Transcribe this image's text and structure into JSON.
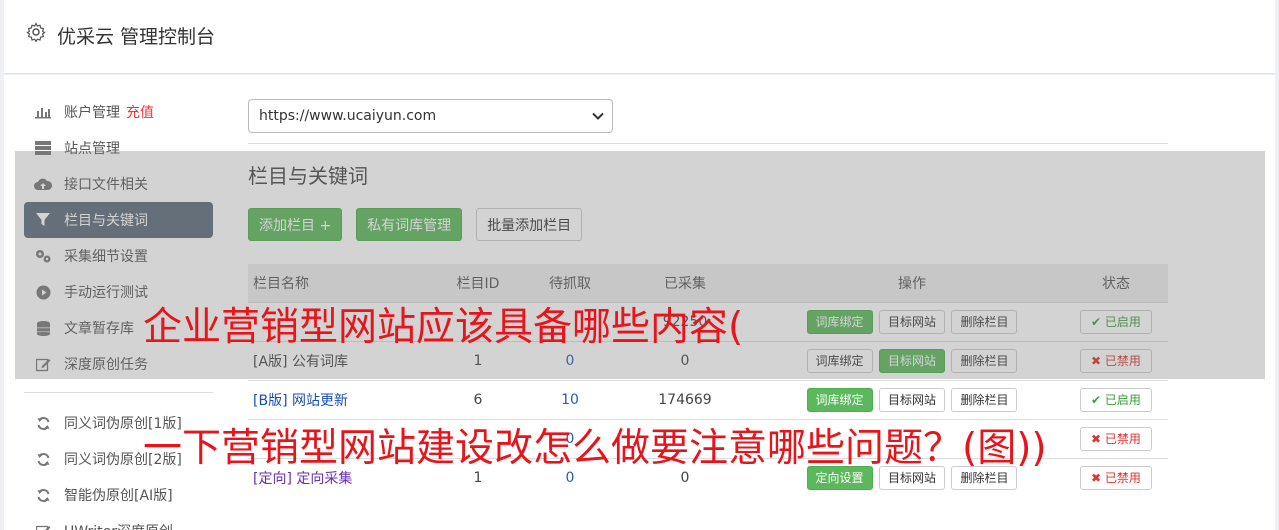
{
  "header": {
    "title": "优采云 管理控制台",
    "icon": "gear-icon"
  },
  "sidebar": {
    "items": [
      {
        "label": "账户管理",
        "extra": "充值",
        "icon": "bar-chart-icon"
      },
      {
        "label": "站点管理",
        "icon": "server-icon"
      },
      {
        "label": "接口文件相关",
        "icon": "cloud-upload-icon"
      },
      {
        "label": "栏目与关键词",
        "icon": "filter-icon",
        "active": true
      },
      {
        "label": "采集细节设置",
        "icon": "gears-icon"
      },
      {
        "label": "手动运行测试",
        "icon": "play-icon"
      },
      {
        "label": "文章暂存库",
        "icon": "database-icon"
      },
      {
        "label": "深度原创任务",
        "icon": "edit-icon"
      }
    ],
    "items2": [
      {
        "label": "同义词伪原创[1版]",
        "icon": "refresh-icon"
      },
      {
        "label": "同义词伪原创[2版]",
        "icon": "refresh-icon"
      },
      {
        "label": "智能伪原创[AI版]",
        "icon": "refresh-icon"
      },
      {
        "label": "UWriter深度原创",
        "icon": "edit-icon"
      }
    ]
  },
  "main": {
    "site_select": "https://www.ucaiyun.com",
    "section_title": "栏目与关键词",
    "buttons": {
      "add": "添加栏目 +",
      "private": "私有词库管理",
      "batch": "批量添加栏目"
    },
    "columns": [
      "栏目名称",
      "栏目ID",
      "待抓取",
      "已采集",
      "操作",
      "状态"
    ],
    "rows": [
      {
        "tag": "[A版]",
        "name": "公有词库",
        "id": "1",
        "pending": "0",
        "collected": "0",
        "op1": "词库绑定",
        "op2": "目标网站",
        "op3": "删除栏目",
        "state": "已禁用"
      },
      {
        "tag": "[B版]",
        "name": "网站更新",
        "id": "6",
        "pending": "10",
        "collected": "174669",
        "op1": "词库绑定",
        "op2": "目标网站",
        "op3": "删除栏目",
        "state": "已启用"
      },
      {
        "tag": "[定向]",
        "name": "定向采集",
        "id": "1",
        "pending": "0",
        "collected": "0",
        "op1": "定向设置",
        "op2": "目标网站",
        "op3": "删除栏目",
        "state": "已禁用"
      }
    ],
    "partial_row_1": {
      "collected": "92250",
      "op1": "词库绑定",
      "op2": "目标网站",
      "op3": "删除栏目",
      "state": "已启用"
    },
    "partial_row_4": {
      "pending": "0",
      "state": "已禁用"
    }
  },
  "overlay": {
    "line1": "企业营销型网站应该具备哪些内容(",
    "line2": "一下营销型网站建设改怎么做要注意哪些问题？(图))"
  },
  "colors": {
    "accent_green": "#5cb85c",
    "overlay_red": "#e8141b",
    "active_nav": "#5a6a7a"
  }
}
